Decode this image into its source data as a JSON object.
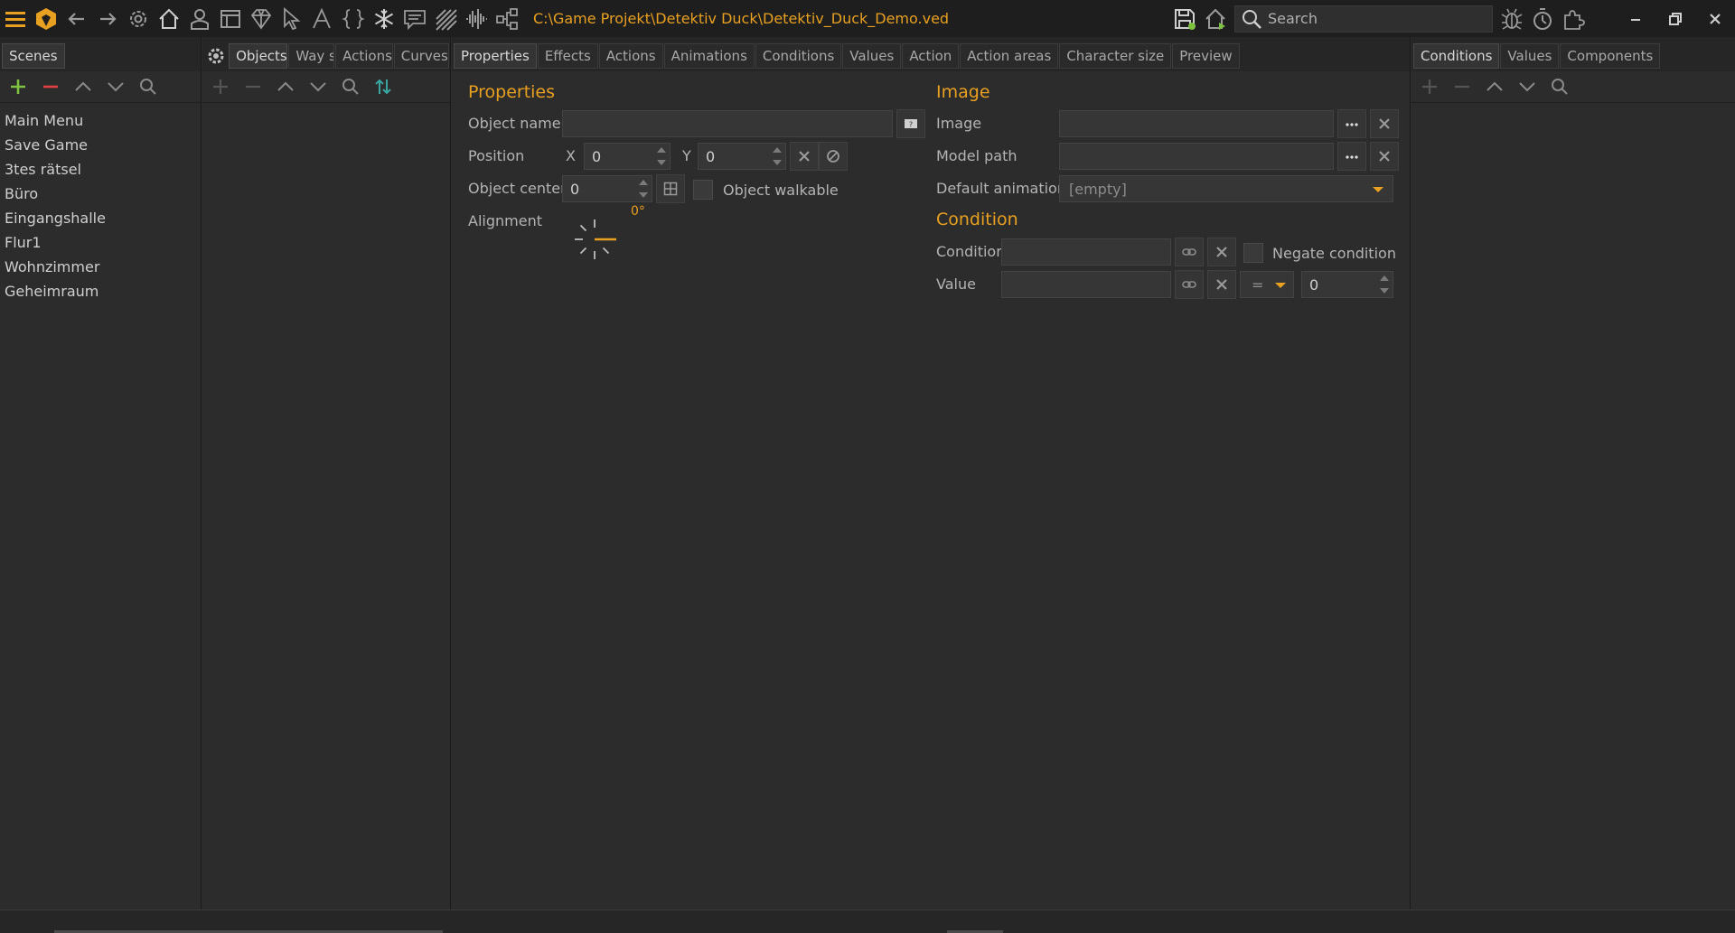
{
  "toolbar": {
    "project_path": "C:\\Game Projekt\\Detektiv Duck\\Detektiv_Duck_Demo.ved",
    "search_placeholder": "Search"
  },
  "scenes_panel": {
    "tab": "Scenes",
    "items": [
      "Main Menu",
      "Save Game",
      "3tes rätsel",
      "Büro",
      "Eingangshalle",
      "Flur1",
      "Wohnzimmer",
      "Geheimraum"
    ]
  },
  "objects_panel": {
    "tabs": [
      "Objects",
      "Way sys",
      "Actions",
      "Curves"
    ]
  },
  "props_panel": {
    "tabs": [
      "Properties",
      "Effects",
      "Actions",
      "Animations",
      "Conditions",
      "Values",
      "Action",
      "Action areas",
      "Character size",
      "Preview"
    ],
    "properties": {
      "title": "Properties",
      "object_name_label": "Object name",
      "object_name_value": "",
      "position_label": "Position",
      "x_label": "X",
      "x_value": "0",
      "y_label": "Y",
      "y_value": "0",
      "object_center_label": "Object center",
      "object_center_value": "0",
      "object_walkable_label": "Object walkable",
      "alignment_label": "Alignment",
      "alignment_angle": "0°"
    },
    "image": {
      "title": "Image",
      "image_label": "Image",
      "image_value": "",
      "model_path_label": "Model path",
      "model_path_value": "",
      "default_animation_label": "Default animation",
      "default_animation_value": "[empty]"
    },
    "condition": {
      "title": "Condition",
      "condition_label": "Condition",
      "negate_label": "Negate condition",
      "value_label": "Value",
      "operator": "=",
      "value": "0"
    }
  },
  "right_panel": {
    "tabs": [
      "Conditions",
      "Values",
      "Components"
    ]
  },
  "colors": {
    "accent": "#e8a020",
    "add_green": "#7fc242",
    "remove_red": "#e04040",
    "teal": "#3aa6a0"
  }
}
